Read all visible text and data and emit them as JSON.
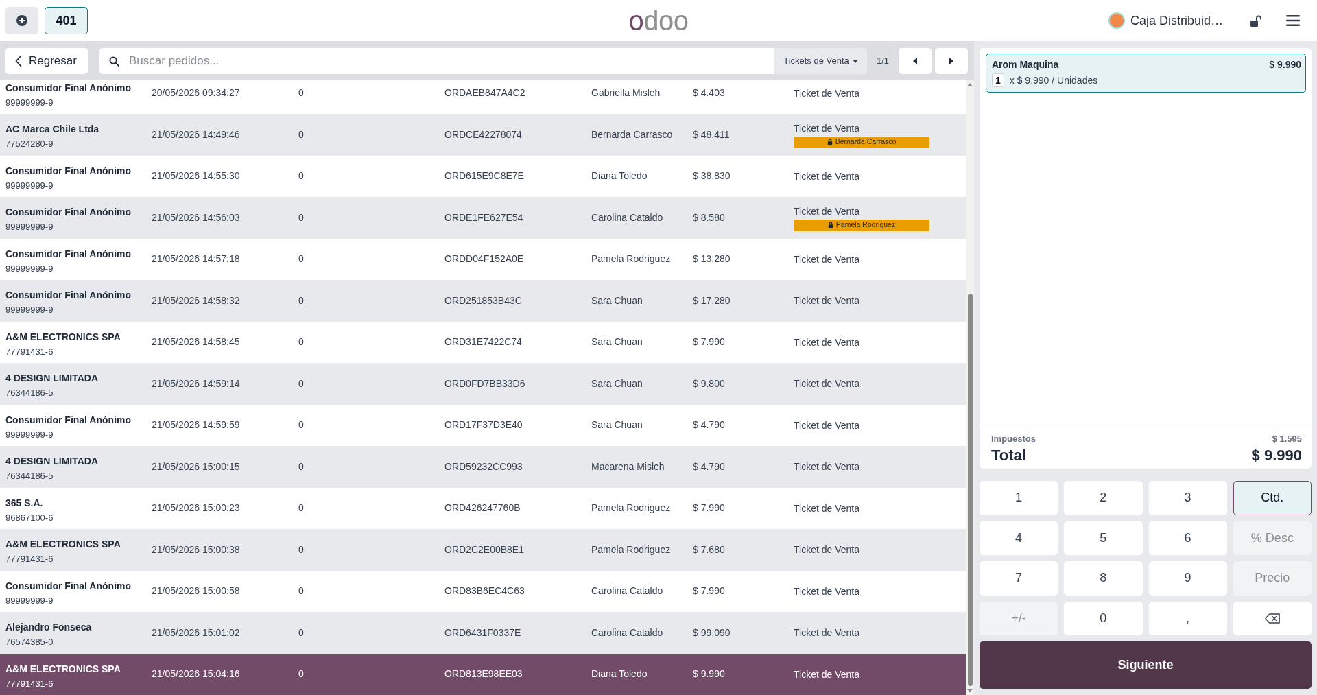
{
  "top_bar": {
    "order_tabs": [
      {
        "label": "401",
        "selected": true
      }
    ],
    "logo": "odoo",
    "cashier": "Caja Distribuid…"
  },
  "toolbar": {
    "back_button": "Regresar",
    "search": {
      "placeholder": "Buscar pedidos..."
    },
    "filter": "Tickets de Venta",
    "pager": "1/1"
  },
  "orders": [
    {
      "selected": false,
      "column_1": [
        "Consumidor Final Anónimo",
        "99999999-9"
      ],
      "column_2": "20/05/2026 09:34:27",
      "column_3": "0",
      "column_4": "ORDAEB847A4C2",
      "column_5": "Gabriella Misleh",
      "column_6": "$ 4.403",
      "column_7": "Ticket de Venta"
    },
    {
      "selected": false,
      "column_1": [
        "AC Marca Chile Ltda",
        "77524280-9"
      ],
      "column_2": "21/05/2026 14:49:46",
      "column_3": "0",
      "column_4": "ORDCE42278074",
      "column_5": "Bernarda Carrasco",
      "column_6": "$ 48.411",
      "column_7": "Ticket de Venta",
      "lock_badge": "Bernarda Carrasco"
    },
    {
      "selected": false,
      "column_1": [
        "Consumidor Final Anónimo",
        "99999999-9"
      ],
      "column_2": "21/05/2026 14:55:30",
      "column_3": "0",
      "column_4": "ORD615E9C8E7E",
      "column_5": "Diana Toledo",
      "column_6": "$ 38.830",
      "column_7": "Ticket de Venta"
    },
    {
      "selected": false,
      "column_1": [
        "Consumidor Final Anónimo",
        "99999999-9"
      ],
      "column_2": "21/05/2026 14:56:03",
      "column_3": "0",
      "column_4": "ORDE1FE627E54",
      "column_5": "Carolina Cataldo",
      "column_6": "$ 8.580",
      "column_7": "Ticket de Venta",
      "lock_badge": "Pamela Rodriguez"
    },
    {
      "selected": false,
      "column_1": [
        "Consumidor Final Anónimo",
        "99999999-9"
      ],
      "column_2": "21/05/2026 14:57:18",
      "column_3": "0",
      "column_4": "ORDD04F152A0E",
      "column_5": "Pamela Rodriguez",
      "column_6": "$ 13.280",
      "column_7": "Ticket de Venta"
    },
    {
      "selected": false,
      "column_1": [
        "Consumidor Final Anónimo",
        "99999999-9"
      ],
      "column_2": "21/05/2026 14:58:32",
      "column_3": "0",
      "column_4": "ORD251853B43C",
      "column_5": "Sara Chuan",
      "column_6": "$ 17.280",
      "column_7": "Ticket de Venta"
    },
    {
      "selected": false,
      "column_1": [
        "A&M ELECTRONICS SPA",
        "77791431-6"
      ],
      "column_2": "21/05/2026 14:58:45",
      "column_3": "0",
      "column_4": "ORD31E7422C74",
      "column_5": "Sara Chuan",
      "column_6": "$ 7.990",
      "column_7": "Ticket de Venta"
    },
    {
      "selected": false,
      "column_1": [
        "4 DESIGN LIMITADA",
        "76344186-5"
      ],
      "column_2": "21/05/2026 14:59:14",
      "column_3": "0",
      "column_4": "ORD0FD7BB33D6",
      "column_5": "Sara Chuan",
      "column_6": "$ 9.800",
      "column_7": "Ticket de Venta"
    },
    {
      "selected": false,
      "column_1": [
        "Consumidor Final Anónimo",
        "99999999-9"
      ],
      "column_2": "21/05/2026 14:59:59",
      "column_3": "0",
      "column_4": "ORD17F37D3E40",
      "column_5": "Sara Chuan",
      "column_6": "$ 4.790",
      "column_7": "Ticket de Venta"
    },
    {
      "selected": false,
      "column_1": [
        "4 DESIGN LIMITADA",
        "76344186-5"
      ],
      "column_2": "21/05/2026 15:00:15",
      "column_3": "0",
      "column_4": "ORD59232CC993",
      "column_5": "Macarena Misleh",
      "column_6": "$ 4.790",
      "column_7": "Ticket de Venta"
    },
    {
      "selected": false,
      "column_1": [
        "365 S.A.",
        "96867100-6"
      ],
      "column_2": "21/05/2026 15:00:23",
      "column_3": "0",
      "column_4": "ORD426247760B",
      "column_5": "Pamela Rodriguez",
      "column_6": "$ 7.990",
      "column_7": "Ticket de Venta"
    },
    {
      "selected": false,
      "column_1": [
        "A&M ELECTRONICS SPA",
        "77791431-6"
      ],
      "column_2": "21/05/2026 15:00:38",
      "column_3": "0",
      "column_4": "ORD2C2E00B8E1",
      "column_5": "Pamela Rodriguez",
      "column_6": "$ 7.680",
      "column_7": "Ticket de Venta"
    },
    {
      "selected": false,
      "column_1": [
        "Consumidor Final Anónimo",
        "99999999-9"
      ],
      "column_2": "21/05/2026 15:00:58",
      "column_3": "0",
      "column_4": "ORD83B6EC4C63",
      "column_5": "Carolina Cataldo",
      "column_6": "$ 7.990",
      "column_7": "Ticket de Venta"
    },
    {
      "selected": false,
      "column_1": [
        "Alejandro Fonseca",
        "76574385-0"
      ],
      "column_2": "21/05/2026 15:01:02",
      "column_3": "0",
      "column_4": "ORD6431F0337E",
      "column_5": "Carolina Cataldo",
      "column_6": "$ 99.090",
      "column_7": "Ticket de Venta"
    },
    {
      "selected": true,
      "column_1": [
        "A&M ELECTRONICS SPA",
        "77791431-6"
      ],
      "column_2": "21/05/2026 15:04:16",
      "column_3": "0",
      "column_4": "ORD813E98EE03",
      "column_5": "Diana Toledo",
      "column_6": "$ 9.990",
      "column_7": "Ticket de Venta"
    }
  ],
  "order_summary": {
    "lines": [
      {
        "product": "Arom Maquina",
        "price": "$ 9.990",
        "quantity": "1",
        "unit_detail": "x $ 9.990 / Unidades",
        "selected": true
      }
    ],
    "taxes_label": "Impuestos",
    "taxes": "$ 1.595",
    "total_label": "Total",
    "total": "$ 9.990"
  },
  "numpad": {
    "keys": [
      {
        "label": "1",
        "kind": "digit",
        "selected": false,
        "disabled": false
      },
      {
        "label": "2",
        "kind": "digit",
        "selected": false,
        "disabled": false
      },
      {
        "label": "3",
        "kind": "digit",
        "selected": false,
        "disabled": false
      },
      {
        "label": "Ctd.",
        "kind": "mode",
        "selected": true,
        "disabled": false
      },
      {
        "label": "4",
        "kind": "digit",
        "selected": false,
        "disabled": false
      },
      {
        "label": "5",
        "kind": "digit",
        "selected": false,
        "disabled": false
      },
      {
        "label": "6",
        "kind": "digit",
        "selected": false,
        "disabled": false
      },
      {
        "label": "% Desc",
        "kind": "mode",
        "selected": false,
        "disabled": true
      },
      {
        "label": "7",
        "kind": "digit",
        "selected": false,
        "disabled": false
      },
      {
        "label": "8",
        "kind": "digit",
        "selected": false,
        "disabled": false
      },
      {
        "label": "9",
        "kind": "digit",
        "selected": false,
        "disabled": false
      },
      {
        "label": "Precio",
        "kind": "mode",
        "selected": false,
        "disabled": true
      },
      {
        "label": "+/-",
        "kind": "sign",
        "selected": false,
        "disabled": true
      },
      {
        "label": "0",
        "kind": "digit",
        "selected": false,
        "disabled": false
      },
      {
        "label": ",",
        "kind": "digit",
        "selected": false,
        "disabled": false
      },
      {
        "kind": "backspace",
        "selected": false,
        "disabled": false
      }
    ]
  },
  "next_button": "Siguiente"
}
